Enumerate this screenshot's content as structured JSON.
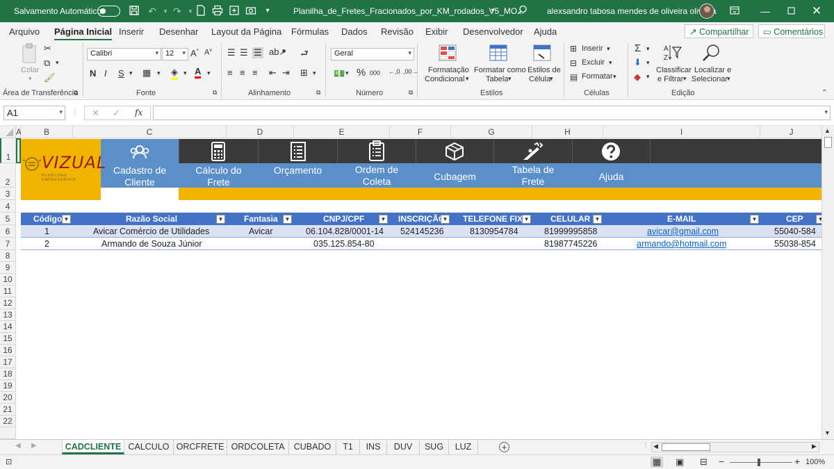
{
  "titlebar": {
    "autosave_label": "Salvamento Automático",
    "filename": "Planilha_de_Fretes_Fracionados_por_KM_rodados_V5_MO...",
    "user_name": "alexsandro tabosa mendes de oliveira oliveira"
  },
  "menu": {
    "tabs": [
      "Arquivo",
      "Página Inicial",
      "Inserir",
      "Desenhar",
      "Layout da Página",
      "Fórmulas",
      "Dados",
      "Revisão",
      "Exibir",
      "Desenvolvedor",
      "Ajuda"
    ],
    "share_label": "Compartilhar",
    "comments_label": "Comentários"
  },
  "ribbon": {
    "clipboard": {
      "paste_label": "Colar",
      "group_label": "Área de Transferência"
    },
    "font": {
      "family": "Calibri",
      "size": "12",
      "bold": "N",
      "italic": "I",
      "underline": "S",
      "group_label": "Fonte"
    },
    "alignment": {
      "group_label": "Alinhamento"
    },
    "number": {
      "format": "Geral",
      "group_label": "Número"
    },
    "styles": {
      "conditional_line1": "Formatação",
      "conditional_line2": "Condicional",
      "table_line1": "Formatar como",
      "table_line2": "Tabela",
      "cellstyles_line1": "Estilos de",
      "cellstyles_line2": "Célula",
      "group_label": "Estilos"
    },
    "cells": {
      "insert": "Inserir",
      "delete": "Excluir",
      "format": "Formatar",
      "group_label": "Células"
    },
    "editing": {
      "sort_line1": "Classificar",
      "sort_line2": "e Filtrar",
      "find_line1": "Localizar e",
      "find_line2": "Selecionar",
      "group_label": "Edição"
    }
  },
  "formula_bar": {
    "name_box": "A1",
    "fx": "fx",
    "formula": ""
  },
  "columns": [
    "A",
    "B",
    "C",
    "D",
    "E",
    "F",
    "G",
    "H",
    "I",
    "J"
  ],
  "rows": [
    "1",
    "2",
    "3",
    "4",
    "5",
    "6",
    "7",
    "8",
    "9",
    "10",
    "11",
    "12",
    "13",
    "14",
    "15",
    "16",
    "17",
    "18",
    "19",
    "20",
    "21",
    "22"
  ],
  "logo": {
    "text": "VIZUAL",
    "tagline": "PLANILHAS EMPRESARIAIS"
  },
  "nav": {
    "items": [
      {
        "line1": "Cadastro de",
        "line2": "Cliente",
        "icon": "users-icon"
      },
      {
        "line1": "Cálculo do",
        "line2": "Frete",
        "icon": "calculator-icon"
      },
      {
        "line1": "Orçamento",
        "line2": "",
        "icon": "document-list-icon"
      },
      {
        "line1": "Ordem de",
        "line2": "Coleta",
        "icon": "clipboard-icon"
      },
      {
        "line1": "Cubagem",
        "line2": "",
        "icon": "box-icon"
      },
      {
        "line1": "Tabela de",
        "line2": "Frete",
        "icon": "ramp-icon"
      },
      {
        "line1": "Ajuda",
        "line2": "",
        "icon": "help-icon"
      }
    ]
  },
  "table": {
    "headers": [
      "Código",
      "Razão Social",
      "Fantasia",
      "CNPJ/CPF",
      "INSCRIÇÃO",
      "TELEFONE FIXO",
      "CELULAR",
      "E-MAIL",
      "CEP"
    ],
    "rows": [
      [
        "1",
        "Avicar Comércio de Utilidades",
        "Avicar",
        "06.104.828/0001-14",
        "524145236",
        "8130954784",
        "81999995858",
        "avicar@gmail.com",
        "55040-584"
      ],
      [
        "2",
        "Armando de Souza Júnior",
        "",
        "035.125.854-80",
        "",
        "",
        "81987745226",
        "armando@hotmail.com",
        "55038-854"
      ]
    ]
  },
  "sheet_tabs": [
    "CADCLIENTE",
    "CALCULO",
    "ORCFRETE",
    "ORDCOLETA",
    "CUBADO",
    "T1",
    "INS",
    "DUV",
    "SUG",
    "LUZ"
  ],
  "status": {
    "zoom": "100%"
  },
  "colors": {
    "excel_green": "#217346",
    "nav_dark": "#3a3a3a",
    "nav_blue": "#5b8fc9",
    "header_blue": "#4472c4",
    "logo_yellow": "#f0b400",
    "row_band": "#d9e1f2"
  }
}
